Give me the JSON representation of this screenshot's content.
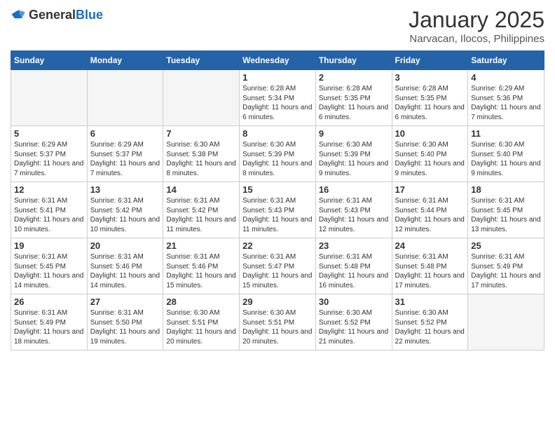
{
  "header": {
    "logo_general": "General",
    "logo_blue": "Blue",
    "month_title": "January 2025",
    "location": "Narvacan, Ilocos, Philippines"
  },
  "weekdays": [
    "Sunday",
    "Monday",
    "Tuesday",
    "Wednesday",
    "Thursday",
    "Friday",
    "Saturday"
  ],
  "weeks": [
    [
      {
        "day": "",
        "empty": true
      },
      {
        "day": "",
        "empty": true
      },
      {
        "day": "",
        "empty": true
      },
      {
        "day": "1",
        "sunrise": "6:28 AM",
        "sunset": "5:34 PM",
        "daylight": "11 hours and 6 minutes."
      },
      {
        "day": "2",
        "sunrise": "6:28 AM",
        "sunset": "5:35 PM",
        "daylight": "11 hours and 6 minutes."
      },
      {
        "day": "3",
        "sunrise": "6:28 AM",
        "sunset": "5:35 PM",
        "daylight": "11 hours and 6 minutes."
      },
      {
        "day": "4",
        "sunrise": "6:29 AM",
        "sunset": "5:36 PM",
        "daylight": "11 hours and 7 minutes."
      }
    ],
    [
      {
        "day": "5",
        "sunrise": "6:29 AM",
        "sunset": "5:37 PM",
        "daylight": "11 hours and 7 minutes."
      },
      {
        "day": "6",
        "sunrise": "6:29 AM",
        "sunset": "5:37 PM",
        "daylight": "11 hours and 7 minutes."
      },
      {
        "day": "7",
        "sunrise": "6:30 AM",
        "sunset": "5:38 PM",
        "daylight": "11 hours and 8 minutes."
      },
      {
        "day": "8",
        "sunrise": "6:30 AM",
        "sunset": "5:39 PM",
        "daylight": "11 hours and 8 minutes."
      },
      {
        "day": "9",
        "sunrise": "6:30 AM",
        "sunset": "5:39 PM",
        "daylight": "11 hours and 9 minutes."
      },
      {
        "day": "10",
        "sunrise": "6:30 AM",
        "sunset": "5:40 PM",
        "daylight": "11 hours and 9 minutes."
      },
      {
        "day": "11",
        "sunrise": "6:30 AM",
        "sunset": "5:40 PM",
        "daylight": "11 hours and 9 minutes."
      }
    ],
    [
      {
        "day": "12",
        "sunrise": "6:31 AM",
        "sunset": "5:41 PM",
        "daylight": "11 hours and 10 minutes."
      },
      {
        "day": "13",
        "sunrise": "6:31 AM",
        "sunset": "5:42 PM",
        "daylight": "11 hours and 10 minutes."
      },
      {
        "day": "14",
        "sunrise": "6:31 AM",
        "sunset": "5:42 PM",
        "daylight": "11 hours and 11 minutes."
      },
      {
        "day": "15",
        "sunrise": "6:31 AM",
        "sunset": "5:43 PM",
        "daylight": "11 hours and 11 minutes."
      },
      {
        "day": "16",
        "sunrise": "6:31 AM",
        "sunset": "5:43 PM",
        "daylight": "11 hours and 12 minutes."
      },
      {
        "day": "17",
        "sunrise": "6:31 AM",
        "sunset": "5:44 PM",
        "daylight": "11 hours and 12 minutes."
      },
      {
        "day": "18",
        "sunrise": "6:31 AM",
        "sunset": "5:45 PM",
        "daylight": "11 hours and 13 minutes."
      }
    ],
    [
      {
        "day": "19",
        "sunrise": "6:31 AM",
        "sunset": "5:45 PM",
        "daylight": "11 hours and 14 minutes."
      },
      {
        "day": "20",
        "sunrise": "6:31 AM",
        "sunset": "5:46 PM",
        "daylight": "11 hours and 14 minutes."
      },
      {
        "day": "21",
        "sunrise": "6:31 AM",
        "sunset": "5:46 PM",
        "daylight": "11 hours and 15 minutes."
      },
      {
        "day": "22",
        "sunrise": "6:31 AM",
        "sunset": "5:47 PM",
        "daylight": "11 hours and 15 minutes."
      },
      {
        "day": "23",
        "sunrise": "6:31 AM",
        "sunset": "5:48 PM",
        "daylight": "11 hours and 16 minutes."
      },
      {
        "day": "24",
        "sunrise": "6:31 AM",
        "sunset": "5:48 PM",
        "daylight": "11 hours and 17 minutes."
      },
      {
        "day": "25",
        "sunrise": "6:31 AM",
        "sunset": "5:49 PM",
        "daylight": "11 hours and 17 minutes."
      }
    ],
    [
      {
        "day": "26",
        "sunrise": "6:31 AM",
        "sunset": "5:49 PM",
        "daylight": "11 hours and 18 minutes."
      },
      {
        "day": "27",
        "sunrise": "6:31 AM",
        "sunset": "5:50 PM",
        "daylight": "11 hours and 19 minutes."
      },
      {
        "day": "28",
        "sunrise": "6:30 AM",
        "sunset": "5:51 PM",
        "daylight": "11 hours and 20 minutes."
      },
      {
        "day": "29",
        "sunrise": "6:30 AM",
        "sunset": "5:51 PM",
        "daylight": "11 hours and 20 minutes."
      },
      {
        "day": "30",
        "sunrise": "6:30 AM",
        "sunset": "5:52 PM",
        "daylight": "11 hours and 21 minutes."
      },
      {
        "day": "31",
        "sunrise": "6:30 AM",
        "sunset": "5:52 PM",
        "daylight": "11 hours and 22 minutes."
      },
      {
        "day": "",
        "empty": true
      }
    ]
  ]
}
